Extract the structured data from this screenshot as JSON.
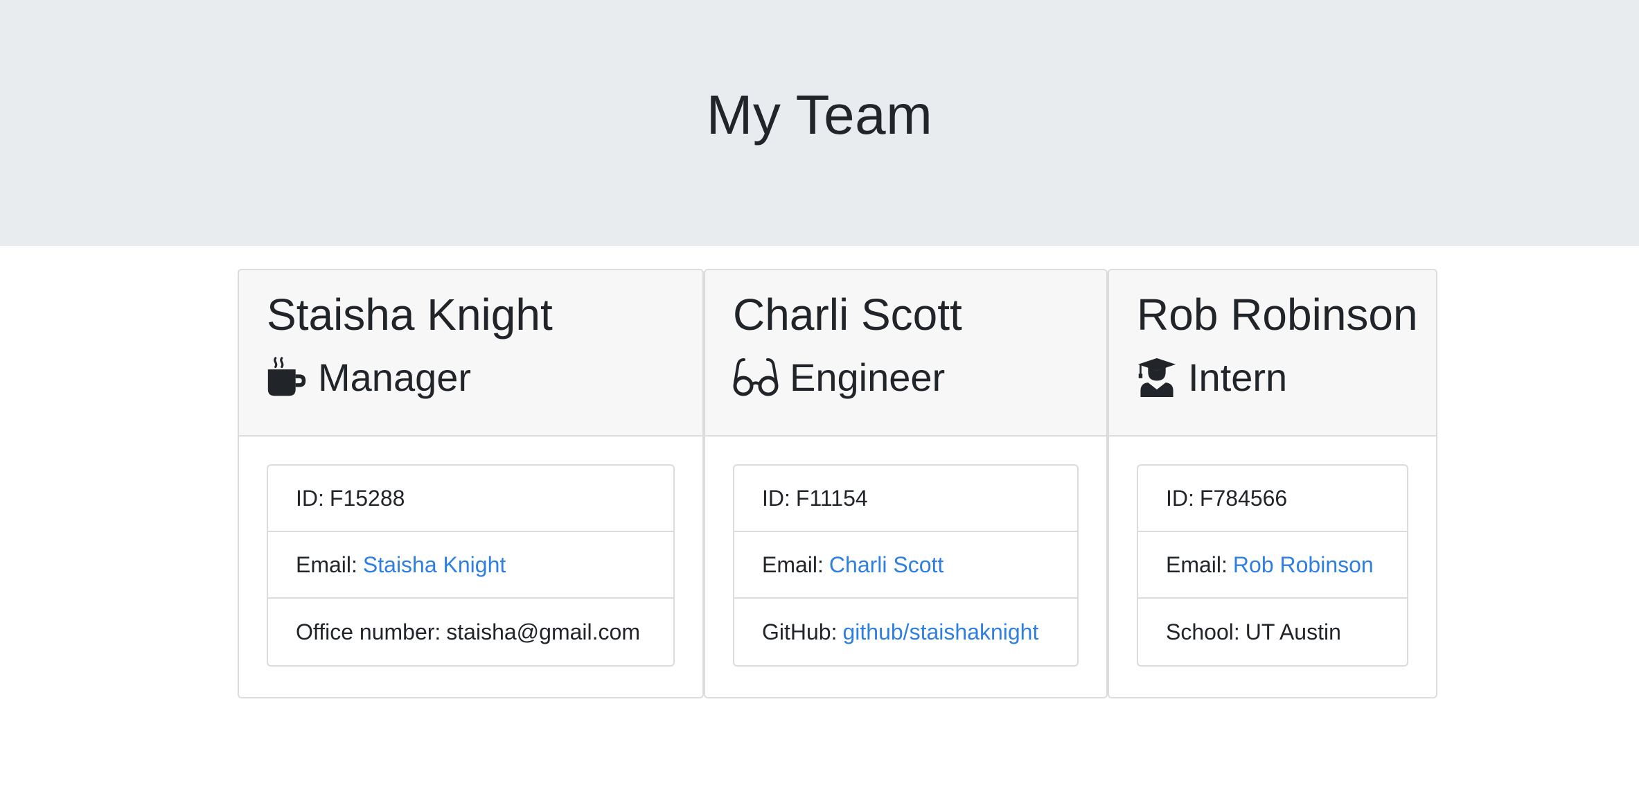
{
  "header": {
    "title": "My Team"
  },
  "employees": [
    {
      "name": "Staisha Knight",
      "role": "Manager",
      "role_icon": "coffee-mug-icon",
      "id_label": "ID:",
      "id": "F15288",
      "email_label": "Email:",
      "email_link": "Staisha Knight",
      "extra_label": "Office number:",
      "extra_value": "staisha@gmail.com"
    },
    {
      "name": "Charli Scott",
      "role": "Engineer",
      "role_icon": "glasses-icon",
      "id_label": "ID:",
      "id": "F11154",
      "email_label": "Email:",
      "email_link": "Charli Scott",
      "extra_label": "GitHub:",
      "extra_value": "github/staishaknight"
    },
    {
      "name": "Rob Robinson",
      "role": "Intern",
      "role_icon": "graduate-icon",
      "id_label": "ID:",
      "id": "F784566",
      "email_label": "Email:",
      "email_link": "Rob Robinson",
      "extra_label": "School:",
      "extra_value": "UT Austin"
    }
  ],
  "colors": {
    "jumbotron_bg": "#e9ecef",
    "card_header_bg": "#f7f7f7",
    "link": "#2f7fe0",
    "text": "#212529",
    "border": "#dcdcdc"
  }
}
